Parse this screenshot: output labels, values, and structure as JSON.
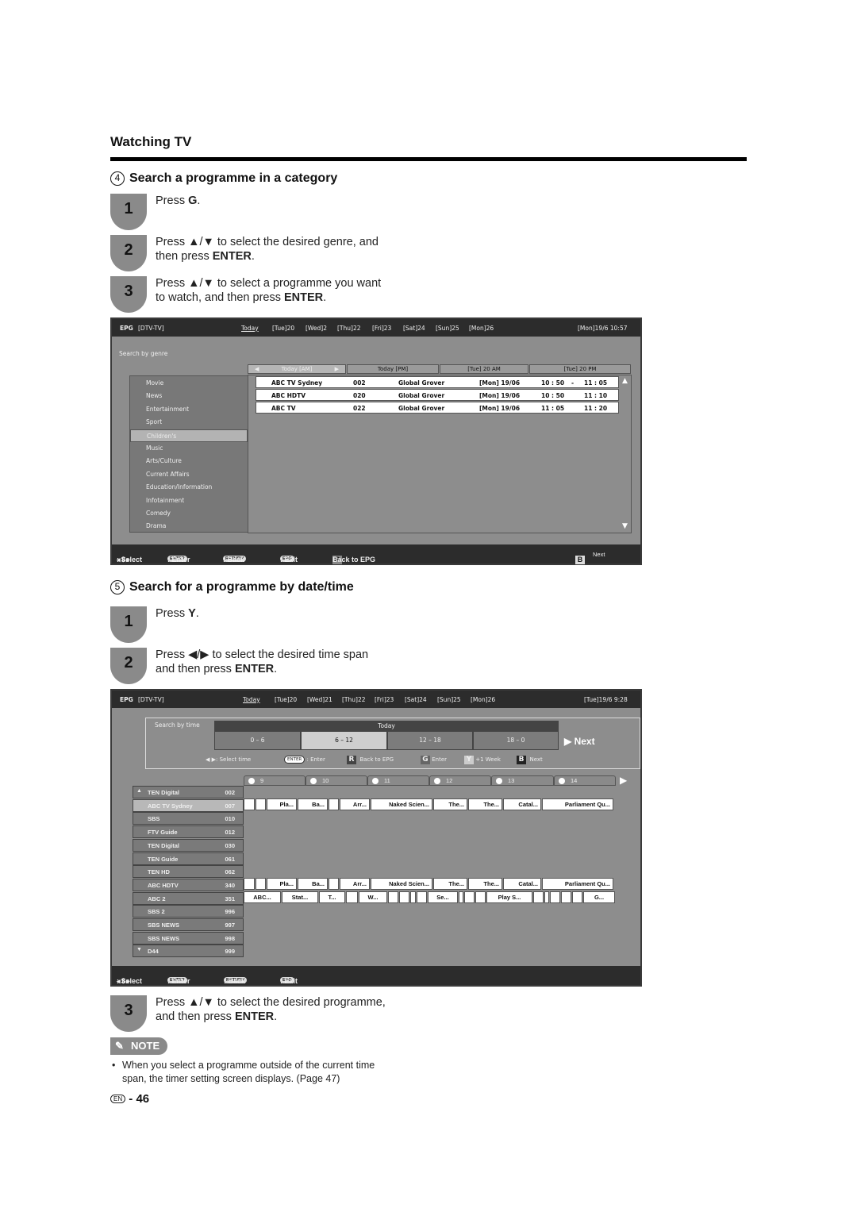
{
  "page": {
    "title": "Watching TV",
    "page_number": "46",
    "lang_badge": "EN"
  },
  "section4": {
    "number": "4",
    "title": "Search a programme in a category",
    "steps": [
      {
        "n": "1",
        "pre": "Press ",
        "bold": "G",
        "post": ".",
        "line2": ""
      },
      {
        "n": "2",
        "pre": "Press ▲/▼ to select the desired genre, and",
        "line2_pre": "then press ",
        "line2_bold": "ENTER",
        "line2_post": "."
      },
      {
        "n": "3",
        "pre": "Press ▲/▼ to select a programme you want",
        "line2_pre": "to watch, and then press ",
        "line2_bold": "ENTER",
        "line2_post": "."
      }
    ]
  },
  "epg1": {
    "label": "EPG",
    "source": "[DTV-TV]",
    "days": [
      "Today",
      "[Tue]20",
      "[Wed]2",
      "[Thu]22",
      "[Fri]23",
      "[Sat]24",
      "[Sun]25",
      "[Mon]26"
    ],
    "clock": "[Mon]19/6  10:57",
    "search_label": "Search by genre",
    "tabs": [
      "Today [AM]",
      "Today [PM]",
      "[Tue] 20 AM",
      "[Tue] 20 PM"
    ],
    "genres": [
      "Movie",
      "News",
      "Entertainment",
      "Sport",
      "Children's",
      "Music",
      "Arts/Culture",
      "Current Affairs",
      "Education/Information",
      "Infotainment",
      "Comedy",
      "Drama"
    ],
    "selected_genre": "Children's",
    "results": [
      {
        "channel": "ABC TV Sydney",
        "number": "002",
        "title": "Global Grover",
        "date": "[Mon] 19/06",
        "start": "10 : 50",
        "sep": "-",
        "end": "11 : 05"
      },
      {
        "channel": "ABC HDTV",
        "number": "020",
        "title": "Global Grover",
        "date": "[Mon] 19/06",
        "start": "10 : 50",
        "sep": "",
        "end": "11 : 10"
      },
      {
        "channel": "ABC TV",
        "number": "022",
        "title": "Global Grover",
        "date": "[Mon] 19/06",
        "start": "11 : 05",
        "sep": "",
        "end": "11 : 20"
      }
    ],
    "footer": {
      "select": ": Select",
      "enter_key": "ENTER",
      "enter": ": Enter",
      "return_key": "RETURN",
      "back": ": Back",
      "epg_key": "EPG",
      "exit": ": Exit",
      "r_key": "R",
      "back_to_epg": "Back to EPG",
      "b_key": "B",
      "next": "Next"
    }
  },
  "section5": {
    "number": "5",
    "title": "Search for a programme by date/time",
    "steps": [
      {
        "n": "1",
        "pre": "Press ",
        "bold": "Y",
        "post": "."
      },
      {
        "n": "2",
        "pre": "Press ◀/▶ to select the desired time span",
        "line2_pre": "and then press ",
        "line2_bold": "ENTER",
        "line2_post": "."
      },
      {
        "n": "3",
        "pre": "Press ▲/▼ to select the desired programme,",
        "line2_pre": "and then press ",
        "line2_bold": "ENTER",
        "line2_post": "."
      }
    ]
  },
  "epg2": {
    "label": "EPG",
    "source": "[DTV-TV]",
    "days": [
      "Today",
      "[Tue]20",
      "[Wed]21",
      "[Thu]22",
      "[Fri]23",
      "[Sat]24",
      "[Sun]25",
      "[Mon]26"
    ],
    "clock": "[Tue]19/6  9:28",
    "search_label": "Search by time",
    "day_header": "Today",
    "spans": [
      "0 – 6",
      "6 – 12",
      "12 – 18",
      "18 – 0"
    ],
    "selected_span": "6 – 12",
    "next_label": "Next",
    "legend": {
      "select_time": ": Select time",
      "enter_key": "ENTER",
      "enter": ": Enter",
      "r_key": "R",
      "back_to_epg": "Back to EPG",
      "g_key": "G",
      "g_label": "Enter",
      "y_key": "Y",
      "y_label": "+1 Week",
      "b_key": "B",
      "b_label": "Next"
    },
    "hours": [
      "9",
      "10",
      "11",
      "12",
      "13",
      "14"
    ],
    "channels": [
      {
        "name": "TEN Digital",
        "number": "002"
      },
      {
        "name": "ABC TV Sydney",
        "number": "007"
      },
      {
        "name": "SBS",
        "number": "010"
      },
      {
        "name": "FTV Guide",
        "number": "012"
      },
      {
        "name": "TEN Digital",
        "number": "030"
      },
      {
        "name": "TEN Guide",
        "number": "061"
      },
      {
        "name": "TEN HD",
        "number": "062"
      },
      {
        "name": "ABC HDTV",
        "number": "340"
      },
      {
        "name": "ABC 2",
        "number": "351"
      },
      {
        "name": "SBS 2",
        "number": "996"
      },
      {
        "name": "SBS NEWS",
        "number": "997"
      },
      {
        "name": "SBS NEWS",
        "number": "998"
      },
      {
        "name": "D44",
        "number": "999"
      }
    ],
    "selected_channel": "ABC TV Sydney",
    "programmes_a": [
      "",
      "",
      "Pla...",
      "Ba...",
      "",
      "Arr...",
      "Naked Scien...",
      "The...",
      "The...",
      "Catal...",
      "Parliament Qu..."
    ],
    "programmes_abc2": [
      "ABC...",
      "Stat...",
      "T...",
      "",
      "W...",
      "",
      "",
      "",
      "",
      "Se...",
      "",
      "",
      "",
      "Play S...",
      "",
      "",
      "",
      "",
      "",
      "G..."
    ],
    "footer": {
      "select": ": Select",
      "enter_key": "ENTER",
      "enter": ": Enter",
      "return_key": "RETURN",
      "back": ": Back",
      "epg_key": "EPG",
      "exit": ": Exit"
    }
  },
  "note": {
    "label": "NOTE",
    "text_line1": "When you select a programme outside of the current time",
    "text_line2": "span, the timer setting screen displays. (Page 47)"
  }
}
